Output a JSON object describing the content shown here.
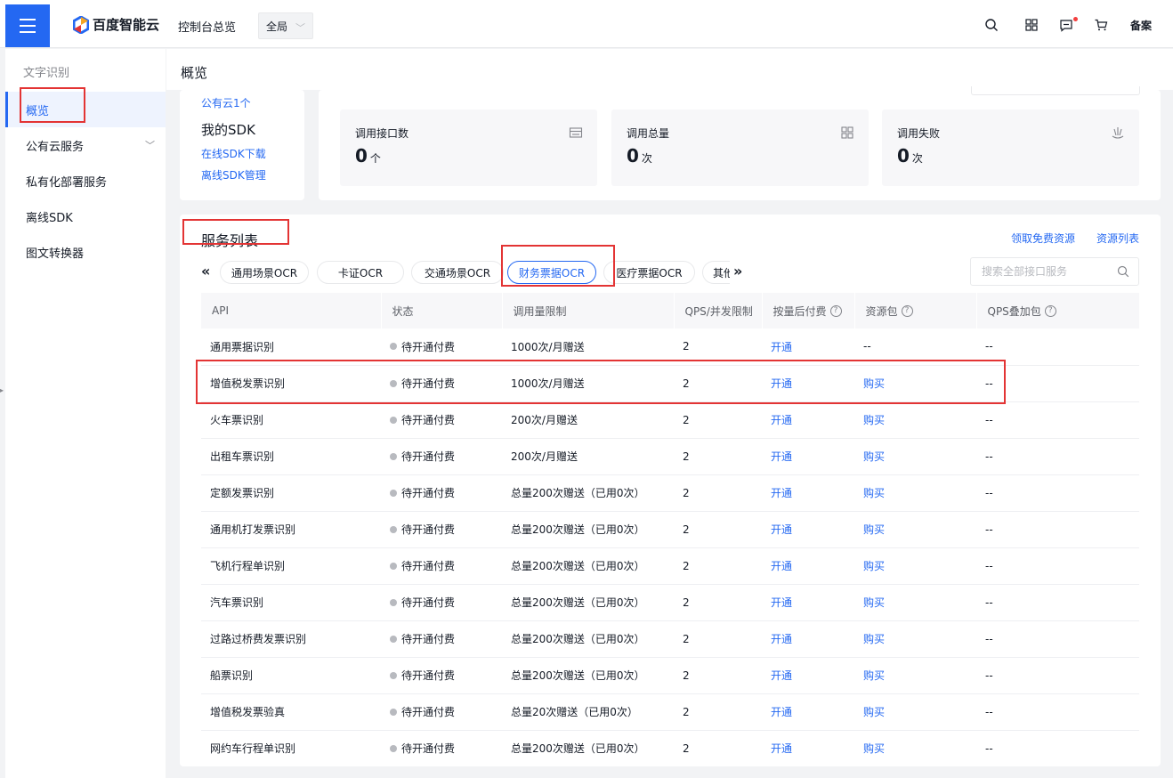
{
  "header": {
    "brand": "百度智能云",
    "console_link": "控制台总览",
    "region": "全局",
    "filing": "备案",
    "icons": [
      "search-icon",
      "apps-grid-icon",
      "message-icon",
      "cart-icon"
    ]
  },
  "sidebar": {
    "title": "文字识别",
    "items": [
      {
        "label": "概览",
        "active": true
      },
      {
        "label": "公有云服务",
        "has_children": true
      },
      {
        "label": "私有化部署服务"
      },
      {
        "label": "离线SDK"
      },
      {
        "label": "图文转换器"
      }
    ]
  },
  "page": {
    "title": "概览"
  },
  "sdk": {
    "public_cloud_link": "公有云1个",
    "title": "我的SDK",
    "online_download": "在线SDK下载",
    "offline_manage": "离线SDK管理"
  },
  "stats": [
    {
      "label": "调用接口数",
      "value": "0",
      "unit": "个",
      "icon": "interface-icon"
    },
    {
      "label": "调用总量",
      "value": "0",
      "unit": "次",
      "icon": "grid-icon"
    },
    {
      "label": "调用失败",
      "value": "0",
      "unit": "次",
      "icon": "failure-icon"
    }
  ],
  "services": {
    "title": "服务列表",
    "free_resources_link": "领取免费资源",
    "resource_list_link": "资源列表",
    "search_placeholder": "搜索全部接口服务",
    "tabs": [
      "通用场景OCR",
      "卡证OCR",
      "交通场景OCR",
      "财务票据OCR",
      "医疗票据OCR",
      "其他"
    ],
    "active_tab": "财务票据OCR",
    "columns": [
      "API",
      "状态",
      "调用量限制",
      "QPS/并发限制",
      "按量后付费",
      "资源包",
      "QPS叠加包"
    ],
    "rows": [
      [
        "通用票据识别",
        "待开通付费",
        "1000次/月赠送",
        "2",
        "开通",
        "--",
        "--"
      ],
      [
        "增值税发票识别",
        "待开通付费",
        "1000次/月赠送",
        "2",
        "开通",
        "购买",
        "--"
      ],
      [
        "火车票识别",
        "待开通付费",
        "200次/月赠送",
        "2",
        "开通",
        "购买",
        "--"
      ],
      [
        "出租车票识别",
        "待开通付费",
        "200次/月赠送",
        "2",
        "开通",
        "购买",
        "--"
      ],
      [
        "定额发票识别",
        "待开通付费",
        "总量200次赠送（已用0次）",
        "2",
        "开通",
        "购买",
        "--"
      ],
      [
        "通用机打发票识别",
        "待开通付费",
        "总量200次赠送（已用0次）",
        "2",
        "开通",
        "购买",
        "--"
      ],
      [
        "飞机行程单识别",
        "待开通付费",
        "总量200次赠送（已用0次）",
        "2",
        "开通",
        "购买",
        "--"
      ],
      [
        "汽车票识别",
        "待开通付费",
        "总量200次赠送（已用0次）",
        "2",
        "开通",
        "购买",
        "--"
      ],
      [
        "过路过桥费发票识别",
        "待开通付费",
        "总量200次赠送（已用0次）",
        "2",
        "开通",
        "购买",
        "--"
      ],
      [
        "船票识别",
        "待开通付费",
        "总量200次赠送（已用0次）",
        "2",
        "开通",
        "购买",
        "--"
      ],
      [
        "增值税发票验真",
        "待开通付费",
        "总量20次赠送（已用0次）",
        "2",
        "开通",
        "购买",
        "--"
      ],
      [
        "网约车行程单识别",
        "待开通付费",
        "总量200次赠送（已用0次）",
        "2",
        "开通",
        "购买",
        "--"
      ]
    ]
  },
  "colors": {
    "accent": "#2468f2",
    "annotation": "#e33434",
    "status_dot": "#b8babf"
  }
}
